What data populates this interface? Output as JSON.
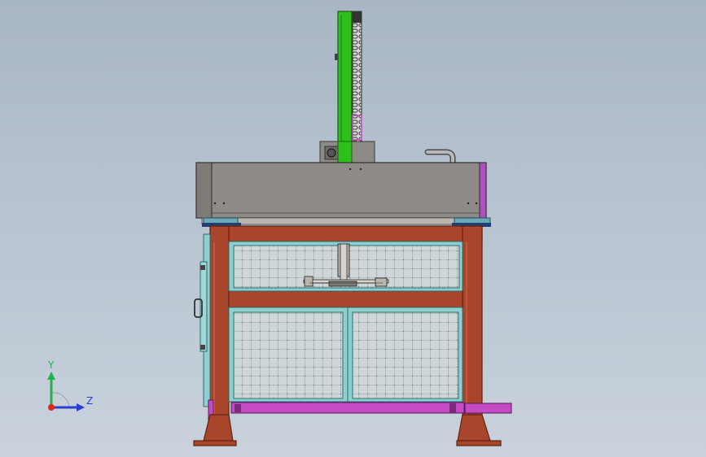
{
  "viewport": {
    "background_top": "#a9b6c6",
    "background_bottom": "#c9d2dc"
  },
  "model": {
    "colors": {
      "frame": "#a8452a",
      "frame_dark": "#5e2414",
      "mesh_panel": "#cfd6d8",
      "panel_border": "#6fb4b0",
      "mast": "#2fbf1d",
      "rack": "#d9d9d9",
      "accent": "#c44bc4",
      "housing": "#8e8b86",
      "housing_dark": "#6b6864"
    }
  },
  "triad": {
    "y_label": "Y",
    "z_label": "Z",
    "y_axis_color": "#22b14c",
    "z_axis_color": "#2a3fd1",
    "x_axis_color": "#e0261b"
  }
}
